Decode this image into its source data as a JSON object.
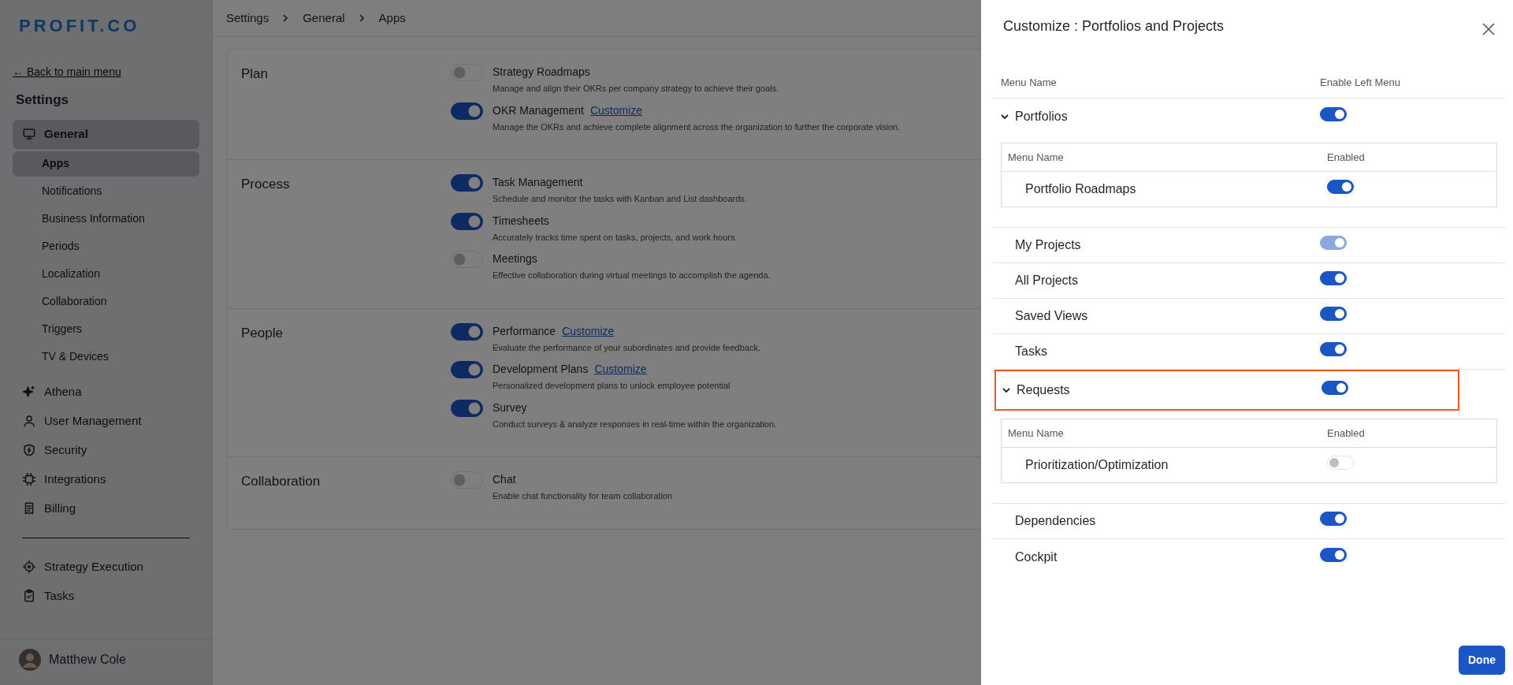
{
  "sidebar": {
    "logo": "PROFIT.CO",
    "back_link": "← Back to main menu",
    "heading": "Settings",
    "nav": [
      {
        "kind": "group",
        "label": "General",
        "selected": true
      },
      {
        "kind": "sub",
        "label": "Apps",
        "selected": true
      },
      {
        "kind": "sub",
        "label": "Notifications",
        "selected": false
      },
      {
        "kind": "sub",
        "label": "Business Information",
        "selected": false
      },
      {
        "kind": "sub",
        "label": "Periods",
        "selected": false
      },
      {
        "kind": "sub",
        "label": "Localization",
        "selected": false
      },
      {
        "kind": "sub",
        "label": "Collaboration",
        "selected": false
      },
      {
        "kind": "sub",
        "label": "Triggers",
        "selected": false
      },
      {
        "kind": "sub",
        "label": "TV & Devices",
        "selected": false
      },
      {
        "kind": "group",
        "label": "Athena",
        "selected": false
      },
      {
        "kind": "group",
        "label": "User Management",
        "selected": false
      },
      {
        "kind": "group",
        "label": "Security",
        "selected": false
      },
      {
        "kind": "group",
        "label": "Integrations",
        "selected": false
      },
      {
        "kind": "group",
        "label": "Billing",
        "selected": false
      }
    ],
    "bottom_nav": [
      {
        "kind": "group",
        "label": "Strategy Execution",
        "selected": false
      },
      {
        "kind": "group",
        "label": "Tasks",
        "selected": false
      }
    ],
    "user": {
      "name": "Matthew Cole"
    }
  },
  "breadcrumb": [
    "Settings",
    "General",
    "Apps"
  ],
  "sections": [
    {
      "title": "Plan",
      "apps": [
        {
          "name": "Strategy Roadmaps",
          "description": "Manage and align their OKRs per company strategy to achieve their goals.",
          "on": false
        },
        {
          "name": "OKR Management",
          "link": "Customize",
          "description": "Manage the OKRs and achieve complete alignment across the organization to further the corporate vision.",
          "on": true
        }
      ]
    },
    {
      "title": "Process",
      "apps": [
        {
          "name": "Task Management",
          "description": "Schedule and monitor the tasks with Kanban and List dashboards.",
          "on": true
        },
        {
          "name": "Timesheets",
          "description": "Accurately tracks time spent on tasks, projects, and work hours.",
          "on": true
        },
        {
          "name": "Meetings",
          "description": "Effective collaboration during virtual meetings to accomplish the agenda.",
          "on": false
        }
      ]
    },
    {
      "title": "People",
      "apps": [
        {
          "name": "Performance",
          "link": "Customize",
          "description": "Evaluate the performance of your subordinates and provide feedback.",
          "on": true
        },
        {
          "name": "Development Plans",
          "link": "Customize",
          "description": "Personalized development plans to unlock employee potential",
          "on": true
        },
        {
          "name": "Survey",
          "description": "Conduct surveys & analyze responses in real-time within the organization.",
          "on": true
        }
      ]
    },
    {
      "title": "Collaboration",
      "apps": [
        {
          "name": "Chat",
          "description": "Enable chat functionality for team collaboration",
          "on": false
        }
      ]
    }
  ],
  "panel": {
    "title": "Customize : Portfolios and Projects",
    "columns": [
      "Menu Name",
      "Enable Left Menu"
    ],
    "rows": [
      {
        "kind": "group",
        "name": "Portfolios",
        "on": true,
        "disabled": false,
        "expanded": true,
        "highlighted": false,
        "child_columns": [
          "Menu Name",
          "Enabled"
        ],
        "children": [
          {
            "name": "Portfolio Roadmaps",
            "on": true,
            "disabled": false
          }
        ]
      },
      {
        "kind": "item",
        "name": "My Projects",
        "on": true,
        "disabled": true,
        "highlighted": false
      },
      {
        "kind": "item",
        "name": "All Projects",
        "on": true,
        "disabled": false,
        "highlighted": false
      },
      {
        "kind": "item",
        "name": "Saved Views",
        "on": true,
        "disabled": false,
        "highlighted": false
      },
      {
        "kind": "item",
        "name": "Tasks",
        "on": true,
        "disabled": false,
        "highlighted": false
      },
      {
        "kind": "group",
        "name": "Requests",
        "on": true,
        "disabled": false,
        "expanded": true,
        "highlighted": true,
        "child_columns": [
          "Menu Name",
          "Enabled"
        ],
        "children": [
          {
            "name": "Prioritization/Optimization",
            "on": false,
            "disabled": false
          }
        ]
      },
      {
        "kind": "item",
        "name": "Dependencies",
        "on": true,
        "disabled": false,
        "highlighted": false
      },
      {
        "kind": "item",
        "name": "Cockpit",
        "on": true,
        "disabled": false,
        "highlighted": false
      }
    ],
    "done_button": "Done"
  }
}
